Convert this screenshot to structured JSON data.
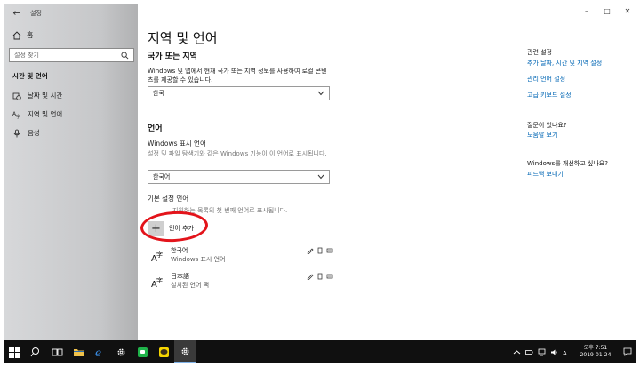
{
  "window": {
    "app_title": "설정",
    "back_icon": "back-arrow-icon",
    "controls": {
      "minimize": "–",
      "maximize": "□",
      "close": "✕"
    }
  },
  "sidebar": {
    "home_label": "홈",
    "search_placeholder": "설정 찾기",
    "section_title": "시간 및 언어",
    "items": [
      {
        "label": "날짜 및 시간",
        "icon": "calendar-clock-icon"
      },
      {
        "label": "지역 및 언어",
        "icon": "region-language-icon"
      },
      {
        "label": "음성",
        "icon": "microphone-icon"
      }
    ]
  },
  "main": {
    "title": "지역 및 언어",
    "country": {
      "heading": "국가 또는 지역",
      "description": "Windows 및 앱에서 현재 국가 또는 지역 정보를 사용하여 로컬 콘텐츠를 제공할 수 있습니다.",
      "value": "한국"
    },
    "language": {
      "heading": "언어",
      "display_label": "Windows 표시 언어",
      "display_description": "설정 및 파일 탐색기와 같은 Windows 기능이 이 언어로 표시됩니다.",
      "display_value": "한국어",
      "preferred_label": "기본 설정 언어",
      "preferred_description": "지원하는 목록의 첫 번째 언어로 표시됩니다.",
      "add_button": "언어 추가",
      "add_icon": "plus-icon",
      "languages": [
        {
          "name": "한국어",
          "sub": "Windows 표시 언어"
        },
        {
          "name": "日本語",
          "sub": "설치된 언어 팩"
        }
      ]
    }
  },
  "right": {
    "related_heading": "관련 설정",
    "related_links": [
      "추가 날짜, 시간 및 지역 설정",
      "관리 언어 설정",
      "고급 키보드 설정"
    ],
    "question_heading": "질문이 있나요?",
    "help_link": "도움말 보기",
    "improve_heading": "Windows를 개선하고 싶나요?",
    "feedback_link": "피드백 보내기"
  },
  "taskbar": {
    "time": "오후 7:51",
    "date": "2019-01-24",
    "accent": "#7fb2e8"
  },
  "colors": {
    "link": "#0066b4",
    "annotation": "#e3141b"
  }
}
